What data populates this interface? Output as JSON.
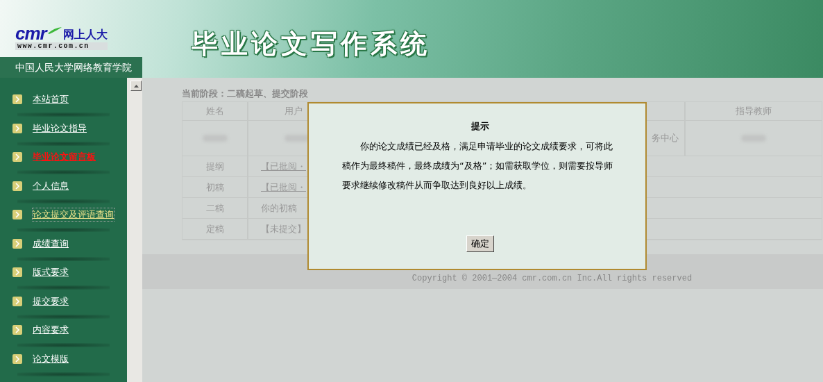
{
  "header": {
    "logo_brand": "cmr",
    "logo_name": "网上人大",
    "logo_url": "www.cmr.com.cn",
    "school": "中国人民大学网络教育学院",
    "title": "毕业论文写作系统"
  },
  "nav": [
    {
      "label": "本站首页",
      "kind": "normal"
    },
    {
      "label": "毕业论文指导",
      "kind": "normal"
    },
    {
      "label": "毕业论文留言板",
      "kind": "highlight"
    },
    {
      "label": "个人信息",
      "kind": "normal"
    },
    {
      "label": "论文提交及评语查询",
      "kind": "current"
    },
    {
      "label": "成绩查询",
      "kind": "normal"
    },
    {
      "label": "版式要求",
      "kind": "normal"
    },
    {
      "label": "提交要求",
      "kind": "normal"
    },
    {
      "label": "内容要求",
      "kind": "normal"
    },
    {
      "label": "论文模版",
      "kind": "normal"
    }
  ],
  "stage": "当前阶段：二稿起草、提交阶段",
  "table": {
    "columns": [
      "姓名",
      "用户",
      "",
      "指导教师"
    ],
    "info_row": {
      "column_3": "务中心"
    },
    "rows": [
      {
        "label": "提纲",
        "value": "【已批阅・",
        "kind": "link"
      },
      {
        "label": "初稿",
        "value": "【已批阅・",
        "kind": "link"
      },
      {
        "label": "二稿",
        "value": "你的初稿",
        "kind": "text"
      },
      {
        "label": "定稿",
        "value": "【未提交】",
        "kind": "text"
      }
    ]
  },
  "footer": "Copyright © 2001—2004 cmr.com.cn Inc.All rights reserved",
  "dialog": {
    "title": "提示",
    "message": "你的论文成绩已经及格，满足申请毕业的论文成绩要求，可将此稿作为最终稿件，最终成绩为“及格”；如需获取学位，则需要按导师要求继续修改稿件从而争取达到良好以上成绩。",
    "button": "确定"
  }
}
